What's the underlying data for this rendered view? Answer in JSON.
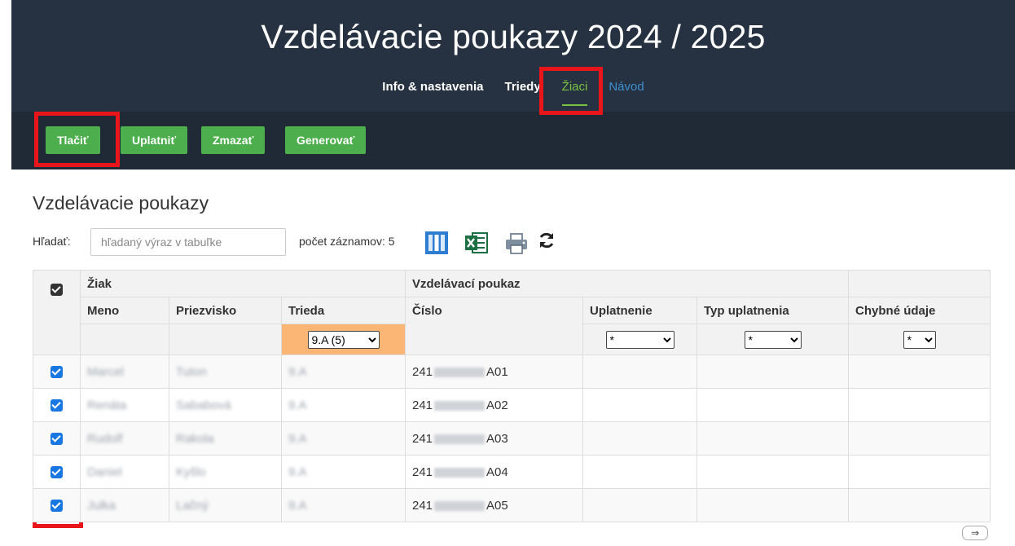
{
  "app": {
    "title": "Vzdelávacie poukazy 2024 / 2025"
  },
  "nav": [
    {
      "label": "Info & nastavenia"
    },
    {
      "label": "Triedy"
    },
    {
      "label": "Žiaci"
    },
    {
      "label": "Návod"
    }
  ],
  "toolbar": {
    "print": "Tlačiť",
    "apply": "Uplatniť",
    "delete": "Zmazať",
    "generate": "Generovať"
  },
  "section": {
    "title": "Vzdelávacie poukazy"
  },
  "search": {
    "label": "Hľadať:",
    "placeholder": "hľadaný výraz v tabuľke",
    "count_label": "počet záznamov: 5"
  },
  "table": {
    "group_student": "Žiak",
    "group_voucher": "Vzdelávací poukaz",
    "col_name": "Meno",
    "col_surname": "Priezvisko",
    "col_class": "Trieda",
    "col_number": "Číslo",
    "col_applied": "Uplatnenie",
    "col_type": "Typ uplatnenia",
    "col_errors": "Chybné údaje",
    "filter_class": "9.A (5)",
    "filter_any": "*",
    "rows": [
      {
        "name": "Marcel",
        "surname": "Tuton",
        "class": "9.A",
        "num_prefix": "241",
        "num_suffix": "A01"
      },
      {
        "name": "Renáta",
        "surname": "Sababová",
        "class": "9.A",
        "num_prefix": "241",
        "num_suffix": "A02"
      },
      {
        "name": "Rudolf",
        "surname": "Rakola",
        "class": "9.A",
        "num_prefix": "241",
        "num_suffix": "A03"
      },
      {
        "name": "Daniel",
        "surname": "Kyšlo",
        "class": "9.A",
        "num_prefix": "241",
        "num_suffix": "A04"
      },
      {
        "name": "Julka",
        "surname": "Lačný",
        "class": "9.A",
        "num_prefix": "241",
        "num_suffix": "A05"
      }
    ]
  },
  "footer": {
    "scroll_arrow": "⇒"
  },
  "colors": {
    "header_bg": "#263241",
    "toolbar_bg": "#1f2a36",
    "button": "#4cae4c",
    "active_nav": "#7bc142",
    "highlight": "#e8161b",
    "filter_bg": "#fbb574"
  }
}
